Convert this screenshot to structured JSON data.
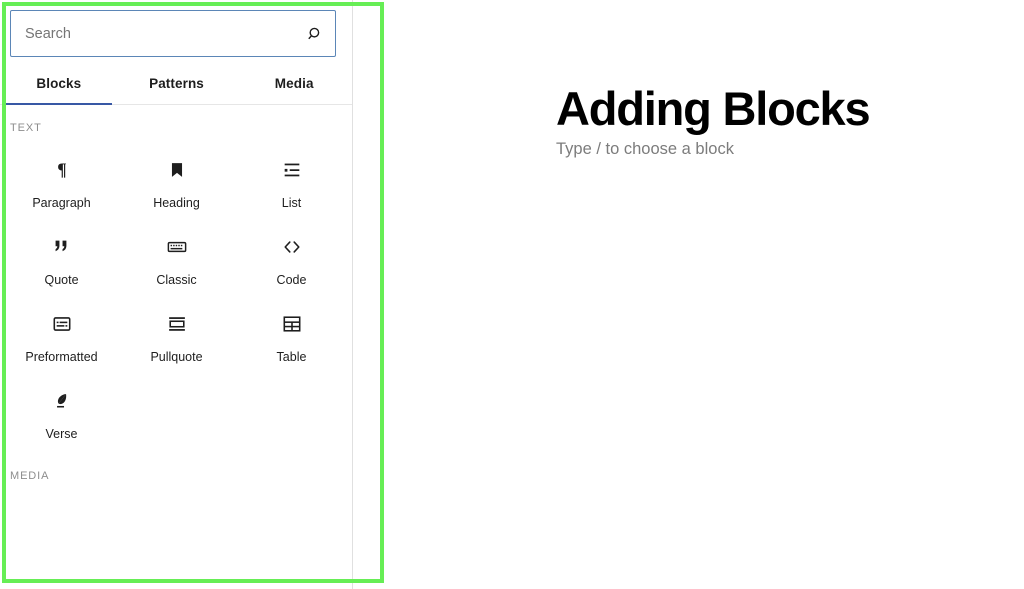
{
  "inserter": {
    "search": {
      "value": "",
      "placeholder": "Search",
      "icon": "search-icon"
    },
    "tabs": [
      {
        "label": "Blocks",
        "active": true
      },
      {
        "label": "Patterns",
        "active": false
      },
      {
        "label": "Media",
        "active": false
      }
    ],
    "categories": [
      {
        "label": "TEXT",
        "blocks": [
          {
            "label": "Paragraph",
            "icon": "paragraph-icon"
          },
          {
            "label": "Heading",
            "icon": "heading-bookmark-icon"
          },
          {
            "label": "List",
            "icon": "list-icon"
          },
          {
            "label": "Quote",
            "icon": "quote-icon"
          },
          {
            "label": "Classic",
            "icon": "keyboard-icon"
          },
          {
            "label": "Code",
            "icon": "code-brackets-icon"
          },
          {
            "label": "Preformatted",
            "icon": "preformatted-icon"
          },
          {
            "label": "Pullquote",
            "icon": "pullquote-icon"
          },
          {
            "label": "Table",
            "icon": "table-icon"
          },
          {
            "label": "Verse",
            "icon": "verse-feather-icon"
          }
        ]
      },
      {
        "label": "MEDIA",
        "blocks": []
      }
    ]
  },
  "editor": {
    "title": "Adding Blocks",
    "paragraph_placeholder": "Type / to choose a block"
  },
  "colors": {
    "highlight_border": "#66ee55",
    "tab_active_underline": "#3858a5",
    "search_border": "#5b86b7",
    "muted_text": "#8d8d8d",
    "placeholder_text": "#757575"
  }
}
